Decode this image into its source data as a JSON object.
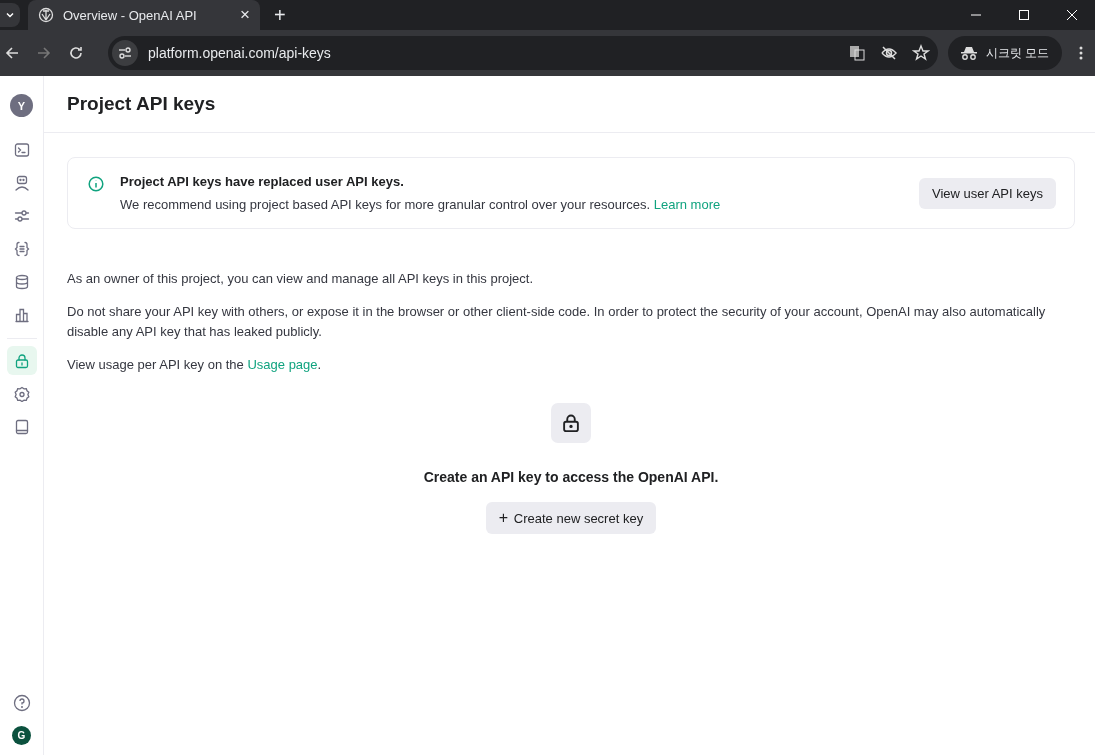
{
  "browser": {
    "tab": {
      "title": "Overview - OpenAI API",
      "close": "×"
    },
    "new_tab": "+",
    "url": "platform.openai.com/api-keys",
    "incognito": "시크릿 모드"
  },
  "sidebar": {
    "avatar": "Y",
    "items": [
      {
        "kind": "terminal",
        "selected": false
      },
      {
        "kind": "robot",
        "selected": false
      },
      {
        "kind": "sliders",
        "selected": false
      },
      {
        "kind": "braces",
        "selected": false
      },
      {
        "kind": "database",
        "selected": false
      },
      {
        "kind": "chart",
        "selected": false
      },
      {
        "kind": "lock",
        "selected": true
      },
      {
        "kind": "gear",
        "selected": false
      },
      {
        "kind": "book",
        "selected": false
      }
    ],
    "bottom_avatar": "G"
  },
  "page": {
    "title": "Project API keys",
    "notice": {
      "heading": "Project API keys have replaced user API keys.",
      "text": "We recommend using project based API keys for more granular control over your resources.",
      "link": "Learn more",
      "button": "View user API keys"
    },
    "paragraphs": [
      {
        "text": "As an owner of this project, you can view and manage all API keys in this project."
      },
      {
        "text": "Do not share your API key with others, or expose it in the browser or other client-side code. In order to protect the security of your account, OpenAI may also automatically disable any API key that has leaked publicly."
      },
      {
        "text": "View usage per API key on the",
        "link": "Usage page",
        "after": "."
      }
    ],
    "empty": {
      "message": "Create an API key to access the OpenAI API.",
      "button_icon": "+",
      "button": "Create new secret key"
    }
  }
}
